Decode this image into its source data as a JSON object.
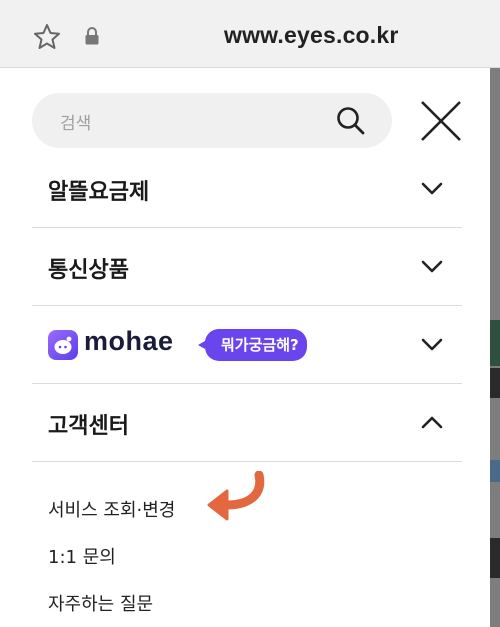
{
  "browser": {
    "url": "www.eyes.co.kr"
  },
  "search": {
    "placeholder": "검색"
  },
  "menu": [
    {
      "label": "알뜰요금제",
      "expanded": false
    },
    {
      "label": "통신상품",
      "expanded": false
    },
    {
      "label": "mohae",
      "badge": "뭐가궁금해?",
      "expanded": false
    },
    {
      "label": "고객센터",
      "expanded": true
    }
  ],
  "customer_center": {
    "items": [
      {
        "label": "서비스 조회·변경"
      },
      {
        "label": "1:1 문의"
      },
      {
        "label": "자주하는 질문"
      }
    ]
  },
  "colors": {
    "accent_purple": "#6a45ee",
    "annotation_orange": "#e4683f"
  }
}
